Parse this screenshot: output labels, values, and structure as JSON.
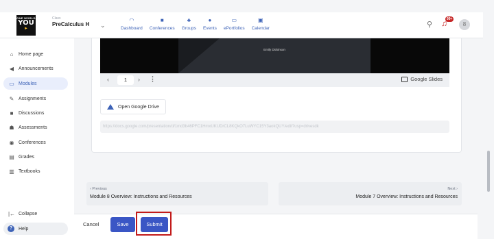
{
  "logo": {
    "line1": "ONE WORLD",
    "line2": "YOU",
    "line3": "►"
  },
  "class_selector": {
    "caption": "Class",
    "value": "PreCalculus H"
  },
  "nav": [
    {
      "label": "Dashboard",
      "icon": "dashboard-icon",
      "glyph": "◠"
    },
    {
      "label": "Conferences",
      "icon": "video-camera-icon",
      "glyph": "■"
    },
    {
      "label": "Groups",
      "icon": "groups-icon",
      "glyph": "♣"
    },
    {
      "label": "Events",
      "icon": "location-pin-icon",
      "glyph": "●"
    },
    {
      "label": "ePortfolios",
      "icon": "portfolio-icon",
      "glyph": "▭"
    },
    {
      "label": "Calendar",
      "icon": "calendar-icon",
      "glyph": "▣"
    }
  ],
  "notifications": {
    "badge": "99+"
  },
  "avatar": {
    "initial": "8"
  },
  "sidebar": {
    "items": [
      {
        "label": "Home page",
        "icon": "home-icon",
        "glyph": "⌂"
      },
      {
        "label": "Announcements",
        "icon": "megaphone-icon",
        "glyph": "◀"
      },
      {
        "label": "Modules",
        "icon": "modules-icon",
        "glyph": "▭",
        "active": true
      },
      {
        "label": "Assignments",
        "icon": "assignment-icon",
        "glyph": "✎"
      },
      {
        "label": "Discussions",
        "icon": "discussion-icon",
        "glyph": "■"
      },
      {
        "label": "Assessments",
        "icon": "assessment-icon",
        "glyph": "☗"
      },
      {
        "label": "Conferences",
        "icon": "conference-icon",
        "glyph": "◉"
      },
      {
        "label": "Grades",
        "icon": "grades-icon",
        "glyph": "▤"
      },
      {
        "label": "Textbooks",
        "icon": "textbook-icon",
        "glyph": "▥"
      }
    ],
    "collapse_label": "Collapse",
    "help_label": "Help"
  },
  "slide": {
    "author": "Emily Dickinson",
    "page": "1",
    "brand": "Google Slides"
  },
  "drive_button": {
    "label": "Open Google Drive"
  },
  "url": "https://docs.google.com/presentation/d/1md3b46PFC1HmxUKUDrCL8KQkO7LuWYC15Y3aokQUY/edit?usp=drivesdk",
  "pager": {
    "prev_caption": "Previous",
    "prev_title": "Module 8 Overview: Instructions and Resources",
    "next_caption": "Next",
    "next_title": "Module 7 Overview: Instructions and Resources"
  },
  "footer": {
    "cancel": "Cancel",
    "save": "Save",
    "submit": "Submit"
  },
  "colors": {
    "accent": "#3a56c5",
    "highlight": "#c21a1a"
  }
}
